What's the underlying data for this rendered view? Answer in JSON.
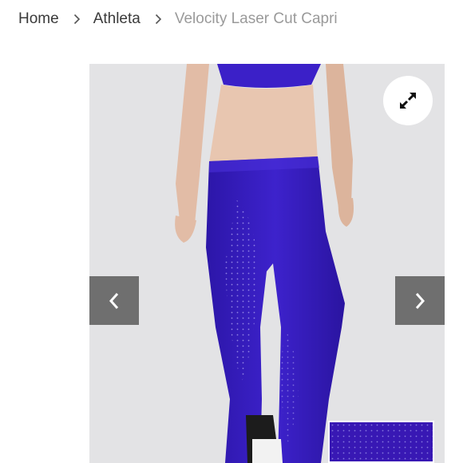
{
  "breadcrumb": {
    "items": [
      "Home",
      "Athleta",
      "Velocity Laser Cut Capri"
    ]
  },
  "viewer": {
    "product_color": "#3b20c8",
    "background_color": "#e3e3e5",
    "icons": {
      "expand": "expand-arrows-icon",
      "prev": "chevron-left-icon",
      "next": "chevron-right-icon",
      "separator": "chevron-right-icon"
    }
  }
}
